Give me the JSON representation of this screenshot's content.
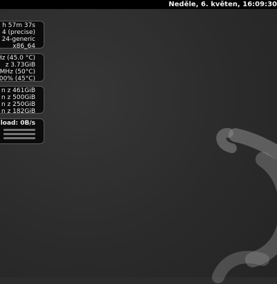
{
  "topbar": {
    "clock": "Neděle, 6. květen, 16:09:30"
  },
  "panels": {
    "system": [
      "h 57m 37s",
      "4 (precise)",
      "24-generic",
      "x86_64"
    ],
    "hardware": [
      "Hz (45.0 °C)",
      "z 3.73GiB",
      "MHz (50°C)",
      "00% (45°C)"
    ],
    "disks": [
      "n z 461GiB",
      "n z 500GiB",
      "n z 250GiB",
      "n z 182GiB"
    ],
    "network": {
      "upload": "load: 0B/s"
    }
  },
  "colors": {
    "logo": "#8f8f8f",
    "panel_border": "#5a5a5a"
  }
}
